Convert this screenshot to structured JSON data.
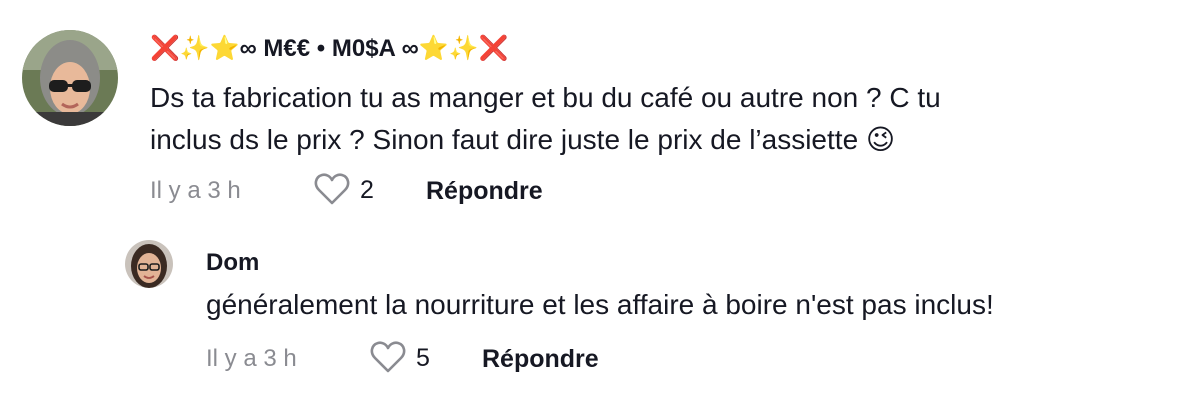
{
  "comments": [
    {
      "username": "❌✨⭐∞ M€€ • M0$A ∞⭐✨❌",
      "text_line1": "Ds ta fabrication tu as manger et bu du café ou autre non ? C tu",
      "text_line2": "inclus ds le prix ? Sinon faut dire juste le prix de l’assiette 😉",
      "time": "Il y a 3 h",
      "likes": "2",
      "reply_label": "Répondre",
      "avatar_icon": "user-avatar-sunglasses"
    }
  ],
  "replies": [
    {
      "username": "Dom",
      "text": "généralement la nourriture et les affaire à boire n'est pas inclus!",
      "time": "Il y a 3 h",
      "likes": "5",
      "reply_label": "Répondre",
      "avatar_icon": "user-avatar-glasses"
    }
  ],
  "colors": {
    "primary_text": "#161823",
    "secondary_text": "#8a8b91"
  }
}
